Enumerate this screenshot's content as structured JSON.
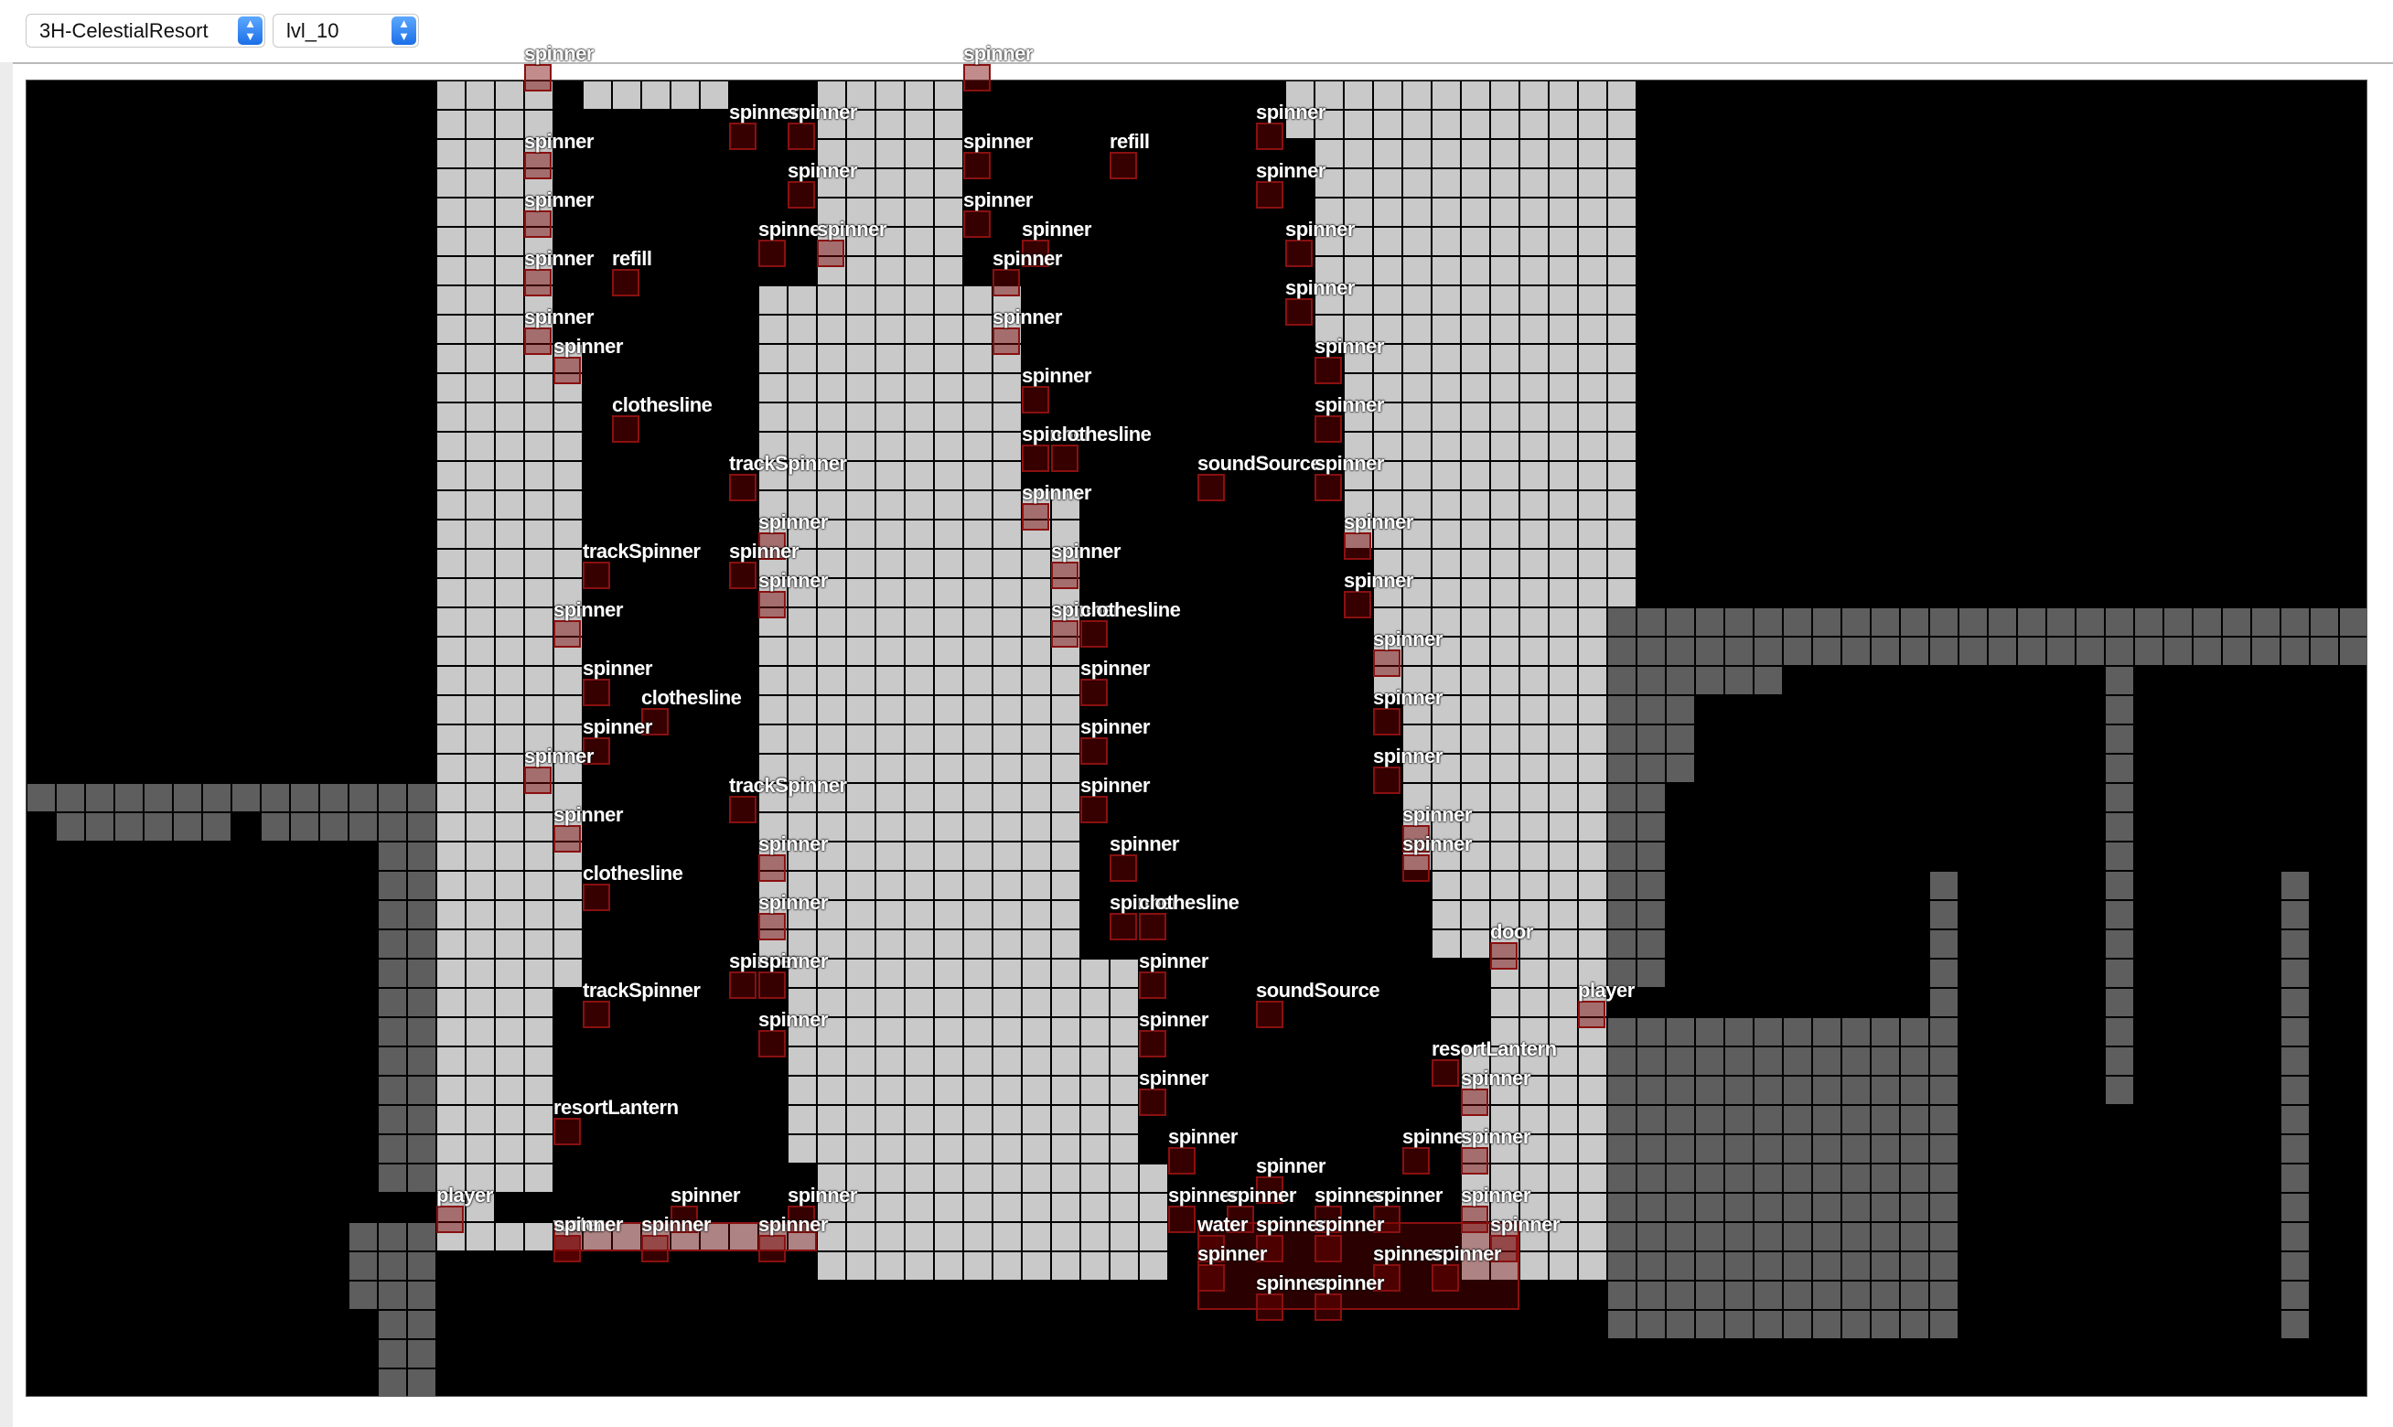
{
  "toolbar": {
    "area_select": {
      "value": "3H-CelestialResort"
    },
    "level_select": {
      "value": "lvl_10"
    }
  },
  "colors": {
    "background": "#000000",
    "solid_tile": "#c9c9c9",
    "background_tile": "#5e5e5e",
    "entity_fill": "#6b0000",
    "entity_border": "#8a1010",
    "label": "#ffffff"
  },
  "entities": [
    {
      "name": "spinner",
      "col": 17,
      "row": -1
    },
    {
      "name": "spinner",
      "col": 24,
      "row": 1
    },
    {
      "name": "spinner",
      "col": 26,
      "row": 1
    },
    {
      "name": "spinner",
      "col": 32,
      "row": -1
    },
    {
      "name": "spinner",
      "col": 17,
      "row": 2
    },
    {
      "name": "spinner",
      "col": 32,
      "row": 2
    },
    {
      "name": "refill",
      "col": 37,
      "row": 2
    },
    {
      "name": "spinner",
      "col": 42,
      "row": 1
    },
    {
      "name": "spinner",
      "col": 26,
      "row": 3
    },
    {
      "name": "spinner",
      "col": 42,
      "row": 3
    },
    {
      "name": "spinner",
      "col": 17,
      "row": 4
    },
    {
      "name": "spinner",
      "col": 32,
      "row": 4
    },
    {
      "name": "spinner",
      "col": 25,
      "row": 5
    },
    {
      "name": "spinner",
      "col": 27,
      "row": 5
    },
    {
      "name": "spinner",
      "col": 34,
      "row": 5
    },
    {
      "name": "spinner",
      "col": 43,
      "row": 5
    },
    {
      "name": "spinner",
      "col": 17,
      "row": 6
    },
    {
      "name": "refill",
      "col": 20,
      "row": 6
    },
    {
      "name": "spinner",
      "col": 33,
      "row": 6
    },
    {
      "name": "spinner",
      "col": 43,
      "row": 7
    },
    {
      "name": "spinner",
      "col": 17,
      "row": 8
    },
    {
      "name": "spinner",
      "col": 33,
      "row": 8
    },
    {
      "name": "spinner",
      "col": 18,
      "row": 9
    },
    {
      "name": "spinner",
      "col": 44,
      "row": 9
    },
    {
      "name": "spinner",
      "col": 34,
      "row": 10
    },
    {
      "name": "clothesline",
      "col": 20,
      "row": 11
    },
    {
      "name": "spinner",
      "col": 44,
      "row": 11
    },
    {
      "name": "spinner",
      "col": 34,
      "row": 12
    },
    {
      "name": "clothesline",
      "col": 35,
      "row": 12
    },
    {
      "name": "trackSpinner",
      "col": 24,
      "row": 13
    },
    {
      "name": "soundSource",
      "col": 40,
      "row": 13
    },
    {
      "name": "spinner",
      "col": 44,
      "row": 13
    },
    {
      "name": "spinner",
      "col": 34,
      "row": 14
    },
    {
      "name": "spinner",
      "col": 25,
      "row": 15
    },
    {
      "name": "spinner",
      "col": 45,
      "row": 15
    },
    {
      "name": "trackSpinner",
      "col": 19,
      "row": 16
    },
    {
      "name": "spinner",
      "col": 24,
      "row": 16
    },
    {
      "name": "spinner",
      "col": 35,
      "row": 16
    },
    {
      "name": "spinner",
      "col": 25,
      "row": 17
    },
    {
      "name": "spinner",
      "col": 45,
      "row": 17
    },
    {
      "name": "spinner",
      "col": 18,
      "row": 18
    },
    {
      "name": "spinner",
      "col": 35,
      "row": 18
    },
    {
      "name": "clothesline",
      "col": 36,
      "row": 18
    },
    {
      "name": "spinner",
      "col": 46,
      "row": 19
    },
    {
      "name": "spinner",
      "col": 19,
      "row": 20
    },
    {
      "name": "spinner",
      "col": 36,
      "row": 20
    },
    {
      "name": "clothesline",
      "col": 21,
      "row": 21
    },
    {
      "name": "spinner",
      "col": 46,
      "row": 21
    },
    {
      "name": "spinner",
      "col": 19,
      "row": 22
    },
    {
      "name": "spinner",
      "col": 36,
      "row": 22
    },
    {
      "name": "spinner",
      "col": 17,
      "row": 23
    },
    {
      "name": "spinner",
      "col": 46,
      "row": 23
    },
    {
      "name": "trackSpinner",
      "col": 24,
      "row": 24
    },
    {
      "name": "spinner",
      "col": 36,
      "row": 24
    },
    {
      "name": "spinner",
      "col": 18,
      "row": 25
    },
    {
      "name": "spinner",
      "col": 47,
      "row": 25
    },
    {
      "name": "spinner",
      "col": 25,
      "row": 26
    },
    {
      "name": "spinner",
      "col": 37,
      "row": 26
    },
    {
      "name": "spinner",
      "col": 47,
      "row": 26
    },
    {
      "name": "clothesline",
      "col": 19,
      "row": 27
    },
    {
      "name": "spinner",
      "col": 25,
      "row": 28
    },
    {
      "name": "spinner",
      "col": 37,
      "row": 28
    },
    {
      "name": "clothesline",
      "col": 38,
      "row": 28
    },
    {
      "name": "door",
      "col": 50,
      "row": 29
    },
    {
      "name": "spinner",
      "col": 24,
      "row": 30
    },
    {
      "name": "spinner",
      "col": 25,
      "row": 30
    },
    {
      "name": "spinner",
      "col": 38,
      "row": 30
    },
    {
      "name": "trackSpinner",
      "col": 19,
      "row": 31
    },
    {
      "name": "soundSource",
      "col": 42,
      "row": 31
    },
    {
      "name": "player",
      "col": 53,
      "row": 31
    },
    {
      "name": "spinner",
      "col": 25,
      "row": 32
    },
    {
      "name": "spinner",
      "col": 38,
      "row": 32
    },
    {
      "name": "resortLantern",
      "col": 48,
      "row": 33
    },
    {
      "name": "spinner",
      "col": 49,
      "row": 34
    },
    {
      "name": "resortLantern",
      "col": 18,
      "row": 35
    },
    {
      "name": "spinner",
      "col": 38,
      "row": 34
    },
    {
      "name": "spinner",
      "col": 39,
      "row": 36
    },
    {
      "name": "spinner",
      "col": 47,
      "row": 36
    },
    {
      "name": "spinner",
      "col": 49,
      "row": 36
    },
    {
      "name": "spinner",
      "col": 42,
      "row": 37
    },
    {
      "name": "player",
      "col": 14,
      "row": 38
    },
    {
      "name": "spinner",
      "col": 22,
      "row": 38
    },
    {
      "name": "spinner",
      "col": 26,
      "row": 38
    },
    {
      "name": "spinner",
      "col": 39,
      "row": 38
    },
    {
      "name": "spinner",
      "col": 41,
      "row": 38
    },
    {
      "name": "spinner",
      "col": 44,
      "row": 38
    },
    {
      "name": "spinner",
      "col": 46,
      "row": 38
    },
    {
      "name": "spinner",
      "col": 49,
      "row": 38
    },
    {
      "name": "water",
      "col": 18,
      "row": 39
    },
    {
      "name": "spinner",
      "col": 18,
      "row": 39
    },
    {
      "name": "spinner",
      "col": 21,
      "row": 39
    },
    {
      "name": "spinner",
      "col": 25,
      "row": 39
    },
    {
      "name": "water",
      "col": 40,
      "row": 39
    },
    {
      "name": "spinner",
      "col": 42,
      "row": 39
    },
    {
      "name": "spinner",
      "col": 44,
      "row": 39
    },
    {
      "name": "spinner",
      "col": 50,
      "row": 39
    },
    {
      "name": "spinner",
      "col": 40,
      "row": 40
    },
    {
      "name": "spinner",
      "col": 46,
      "row": 40
    },
    {
      "name": "spinner",
      "col": 48,
      "row": 40
    },
    {
      "name": "spinner",
      "col": 42,
      "row": 41
    },
    {
      "name": "spinner",
      "col": 44,
      "row": 41
    }
  ],
  "water_zones": [
    {
      "name": "water",
      "col": 18,
      "row": 39,
      "w": 9,
      "h": 1
    },
    {
      "name": "water",
      "col": 40,
      "row": 39,
      "w": 11,
      "h": 3
    }
  ]
}
